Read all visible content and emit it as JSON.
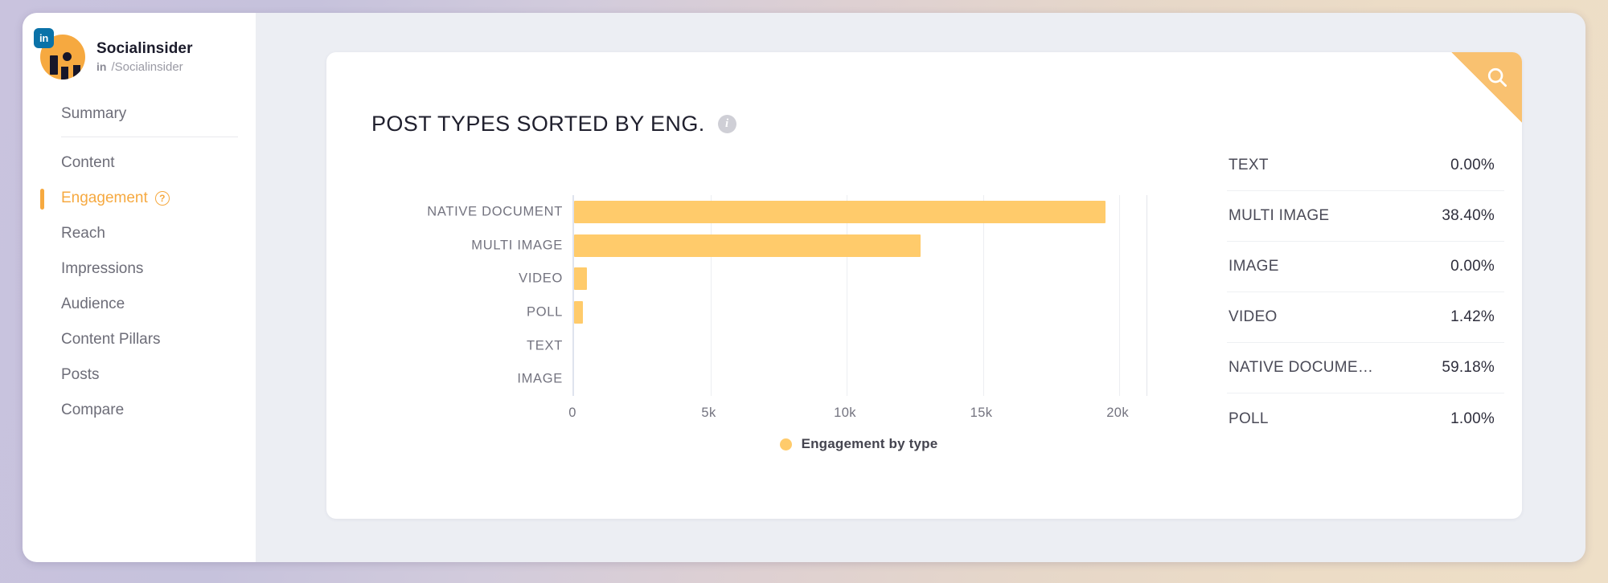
{
  "profile": {
    "name": "Socialinsider",
    "network_label": "in",
    "handle": "/Socialinsider",
    "network_badge": "in"
  },
  "sidebar": {
    "items": [
      {
        "label": "Summary",
        "active": false
      },
      {
        "label": "Content",
        "active": false
      },
      {
        "label": "Engagement",
        "active": true,
        "help": "?"
      },
      {
        "label": "Reach",
        "active": false
      },
      {
        "label": "Impressions",
        "active": false
      },
      {
        "label": "Audience",
        "active": false
      },
      {
        "label": "Content Pillars",
        "active": false
      },
      {
        "label": "Posts",
        "active": false
      },
      {
        "label": "Compare",
        "active": false
      }
    ]
  },
  "card": {
    "title": "POST TYPES SORTED BY ENG.",
    "info_tooltip": "i",
    "search_icon": "search-icon"
  },
  "chart_data": {
    "type": "bar",
    "orientation": "horizontal",
    "title": "POST TYPES SORTED BY ENG.",
    "xlabel": "",
    "ylabel": "",
    "categories": [
      "NATIVE DOCUMENT",
      "MULTI IMAGE",
      "VIDEO",
      "POLL",
      "TEXT",
      "IMAGE"
    ],
    "values": [
      19500,
      12700,
      470,
      330,
      0,
      0
    ],
    "xlim": [
      0,
      21000
    ],
    "xticks": [
      0,
      5000,
      10000,
      15000,
      20000
    ],
    "xticklabels": [
      "0",
      "5k",
      "10k",
      "15k",
      "20k"
    ],
    "grid": true,
    "legend": {
      "position": "bottom",
      "entries": [
        "Engagement by type"
      ]
    },
    "series": [
      {
        "name": "Engagement by type",
        "color": "#ffcb6b",
        "values": [
          19500,
          12700,
          470,
          330,
          0,
          0
        ]
      }
    ]
  },
  "breakdown": {
    "rows": [
      {
        "label": "TEXT",
        "value": "0.00%"
      },
      {
        "label": "MULTI IMAGE",
        "value": "38.40%"
      },
      {
        "label": "IMAGE",
        "value": "0.00%"
      },
      {
        "label": "VIDEO",
        "value": "1.42%"
      },
      {
        "label": "NATIVE DOCUME…",
        "value": "59.18%"
      },
      {
        "label": "POLL",
        "value": "1.00%"
      }
    ]
  },
  "colors": {
    "accent": "#f6a940",
    "bar": "#ffcb6b",
    "linkedin": "#0a72a8",
    "app_bg": "#eceef3"
  }
}
